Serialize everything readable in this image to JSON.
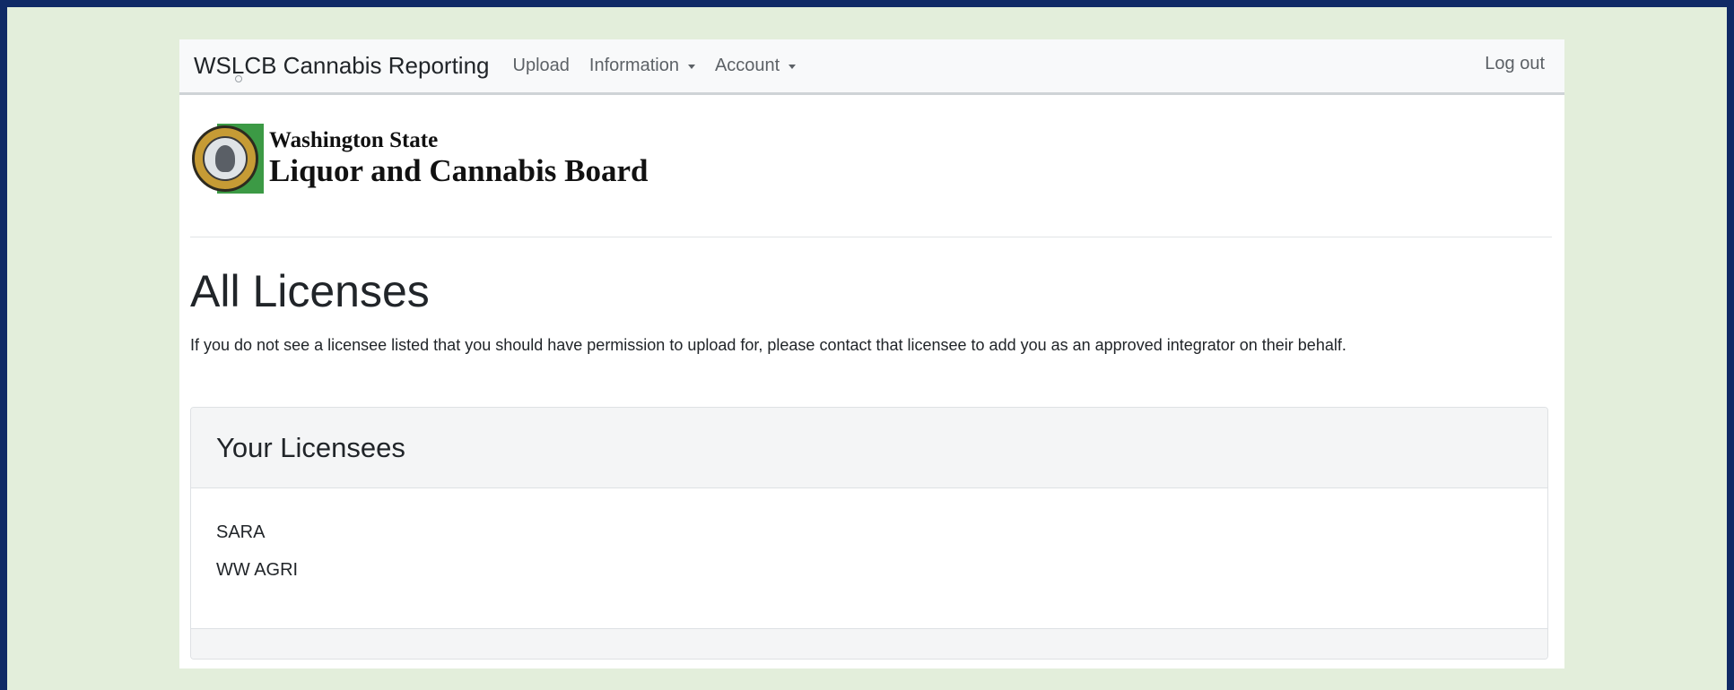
{
  "navbar": {
    "brand": "WSLCB Cannabis Reporting",
    "links": [
      {
        "label": "Upload"
      },
      {
        "label": "Information"
      },
      {
        "label": "Account"
      }
    ],
    "logout": "Log out"
  },
  "logo": {
    "line1": "Washington State",
    "line2": "Liquor and Cannabis Board"
  },
  "page": {
    "title": "All Licenses",
    "intro": "If you do not see a licensee listed that you should have permission to upload for, please contact that licensee to add you as an approved integrator on their behalf."
  },
  "card": {
    "header": "Your Licensees",
    "licensees": [
      "SARA",
      "WW AGRI"
    ]
  },
  "colors": {
    "outer_border": "#102a66",
    "frame_background": "#e3eedb",
    "navbar_background": "#f8f9fa",
    "seal_green": "#3c9a45"
  }
}
